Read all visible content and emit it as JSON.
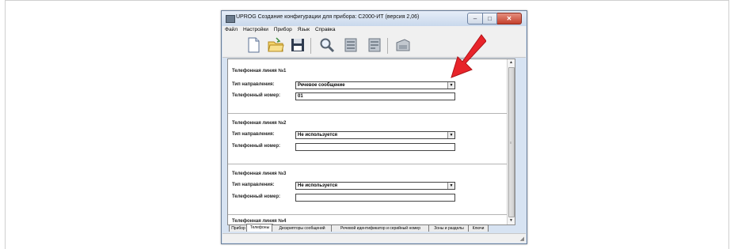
{
  "window": {
    "title": "UPROG  Создание конфигурации для прибора: С2000-ИТ (версия  2,06)",
    "buttons": {
      "minimize": "–",
      "maximize": "□",
      "close": "✕"
    }
  },
  "menu": [
    "Файл",
    "Настройки",
    "Прибор",
    "Язык",
    "Справка"
  ],
  "toolbar": {
    "icons": [
      "new-document-icon",
      "open-folder-icon",
      "save-floppy-icon",
      "search-magnifier-icon",
      "read-device-icon",
      "write-device-icon",
      "device-card-icon"
    ]
  },
  "labels": {
    "direction_type": "Тип направления:",
    "phone_number": "Телефонный номер:"
  },
  "lines": [
    {
      "title": "Телефонная линия №1",
      "direction": "Речевое сообщение",
      "number": "01"
    },
    {
      "title": "Телефонная линия №2",
      "direction": "Не используется",
      "number": ""
    },
    {
      "title": "Телефонная линия №3",
      "direction": "Не используется",
      "number": ""
    },
    {
      "title": "Телефонная линия №4"
    }
  ],
  "tabs": [
    "Прибор",
    "Телефоны",
    "Дескрипторы сообщений",
    "Речевой идентификатор и серийный номер",
    "Зоны и разделы",
    "Ключи"
  ],
  "active_tab": "Телефоны",
  "scrollbar": {
    "up": "▲",
    "down": "▼",
    "grip": "≡"
  },
  "dropdown_arrow": "▼",
  "resize_grip": "◢",
  "colors": {
    "annotation_arrow": "#e8242a",
    "title_bar": "#c9d8ec",
    "close_button": "#c4402c"
  }
}
